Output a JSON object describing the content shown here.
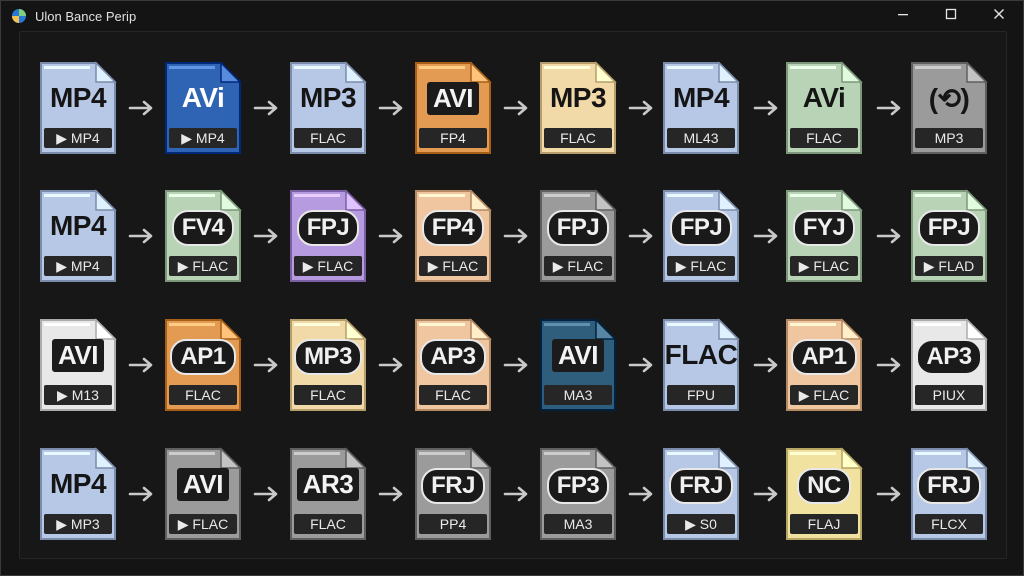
{
  "window": {
    "title": "Ulon Bance Perip",
    "icon": "app-logo-icon",
    "controls": [
      "minimize-icon",
      "maximize-icon",
      "close-icon"
    ]
  },
  "colors": {
    "blue": "#b7c8e6",
    "blue_deep": "#2f64b5",
    "green": "#b8d3b5",
    "orange": "#e39b53",
    "cream": "#f2d9a8",
    "peach": "#f0c6a0",
    "gray": "#9b9b9b",
    "light": "#e8e8e8",
    "purple": "#b79be0",
    "teal": "#2f5d7c",
    "yellow": "#f2e2a0"
  },
  "rows": [
    {
      "tiles": [
        {
          "main": "MP4",
          "sub": "▶ MP4",
          "color": "blue",
          "style": "plain"
        },
        {
          "main": "AVi",
          "sub": "▶ MP4",
          "color": "blue_deep",
          "style": "plain"
        },
        {
          "main": "MP3",
          "sub": "FLAC",
          "color": "blue",
          "style": "plain"
        },
        {
          "main": "AVI",
          "sub": "FP4",
          "color": "orange",
          "style": "box"
        },
        {
          "main": "MP3",
          "sub": "FLAC",
          "color": "cream",
          "style": "plain"
        },
        {
          "main": "MP4",
          "sub": "ML43",
          "color": "blue",
          "style": "plain"
        },
        {
          "main": "AVi",
          "sub": "FLAC",
          "color": "green",
          "style": "plain"
        },
        {
          "main": "(⟲)",
          "sub": "MP3",
          "color": "gray",
          "style": "plain"
        }
      ]
    },
    {
      "tiles": [
        {
          "main": "MP4",
          "sub": "▶ MP4",
          "color": "blue",
          "style": "plain"
        },
        {
          "main": "FV4",
          "sub": "▶ FLAC",
          "color": "green",
          "style": "pill"
        },
        {
          "main": "FPJ",
          "sub": "▶ FLAC",
          "color": "purple",
          "style": "pill"
        },
        {
          "main": "FP4",
          "sub": "▶ FLAC",
          "color": "peach",
          "style": "pill"
        },
        {
          "main": "FPJ",
          "sub": "▶ FLAC",
          "color": "gray",
          "style": "pill"
        },
        {
          "main": "FPJ",
          "sub": "▶ FLAC",
          "color": "blue",
          "style": "pill"
        },
        {
          "main": "FYJ",
          "sub": "▶ FLAC",
          "color": "green",
          "style": "pill"
        },
        {
          "main": "FPJ",
          "sub": "▶ FLAD",
          "color": "green",
          "style": "pill"
        }
      ]
    },
    {
      "tiles": [
        {
          "main": "AVI",
          "sub": "▶ M13",
          "color": "light",
          "style": "box"
        },
        {
          "main": "AP1",
          "sub": "FLAC",
          "color": "orange",
          "style": "pill"
        },
        {
          "main": "MP3",
          "sub": "FLAC",
          "color": "cream",
          "style": "pill"
        },
        {
          "main": "AP3",
          "sub": "FLAC",
          "color": "peach",
          "style": "pill"
        },
        {
          "main": "AVI",
          "sub": "MA3",
          "color": "teal",
          "style": "box"
        },
        {
          "main": "FLAC",
          "sub": "FPU",
          "color": "blue",
          "style": "plain"
        },
        {
          "main": "AP1",
          "sub": "▶ FLAC",
          "color": "peach",
          "style": "pill"
        },
        {
          "main": "AP3",
          "sub": "PIUX",
          "color": "light",
          "style": "pill"
        }
      ]
    },
    {
      "tiles": [
        {
          "main": "MP4",
          "sub": "▶ MP3",
          "color": "blue",
          "style": "plain"
        },
        {
          "main": "AVI",
          "sub": "▶ FLAC",
          "color": "gray",
          "style": "box"
        },
        {
          "main": "AR3",
          "sub": "FLAC",
          "color": "gray",
          "style": "box"
        },
        {
          "main": "FRJ",
          "sub": "PP4",
          "color": "gray",
          "style": "pill"
        },
        {
          "main": "FP3",
          "sub": "MA3",
          "color": "gray",
          "style": "pill"
        },
        {
          "main": "FRJ",
          "sub": "▶ S0",
          "color": "blue",
          "style": "pill"
        },
        {
          "main": "NC",
          "sub": "FLAJ",
          "color": "yellow",
          "style": "pill"
        },
        {
          "main": "FRJ",
          "sub": "FLCX",
          "color": "blue",
          "style": "pill"
        }
      ]
    }
  ]
}
